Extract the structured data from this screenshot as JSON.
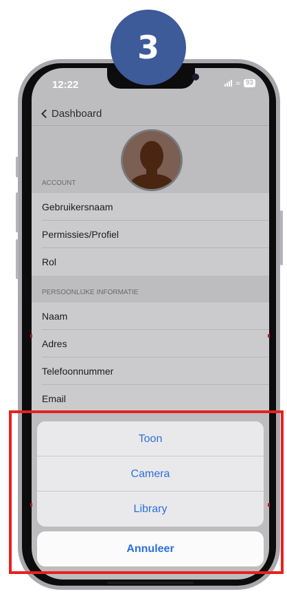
{
  "step_badge": "3",
  "status_bar": {
    "time": "12:22",
    "battery": "93"
  },
  "nav": {
    "back_label": "Dashboard"
  },
  "sections": {
    "account": {
      "header": "ACCOUNT",
      "rows": [
        "Gebruikersnaam",
        "Permissies/Profiel",
        "Rol"
      ]
    },
    "personal": {
      "header": "PERSOONLIJKE INFORMATIE",
      "rows": [
        "Naam",
        "Adres",
        "Telefoonnummer",
        "Email"
      ]
    }
  },
  "action_sheet": {
    "actions": [
      "Toon",
      "Camera",
      "Library"
    ],
    "cancel": "Annuleer"
  },
  "colors": {
    "action_blue": "#2b70dd",
    "badge_blue": "#3d5a99",
    "highlight_red": "#e8201e"
  }
}
